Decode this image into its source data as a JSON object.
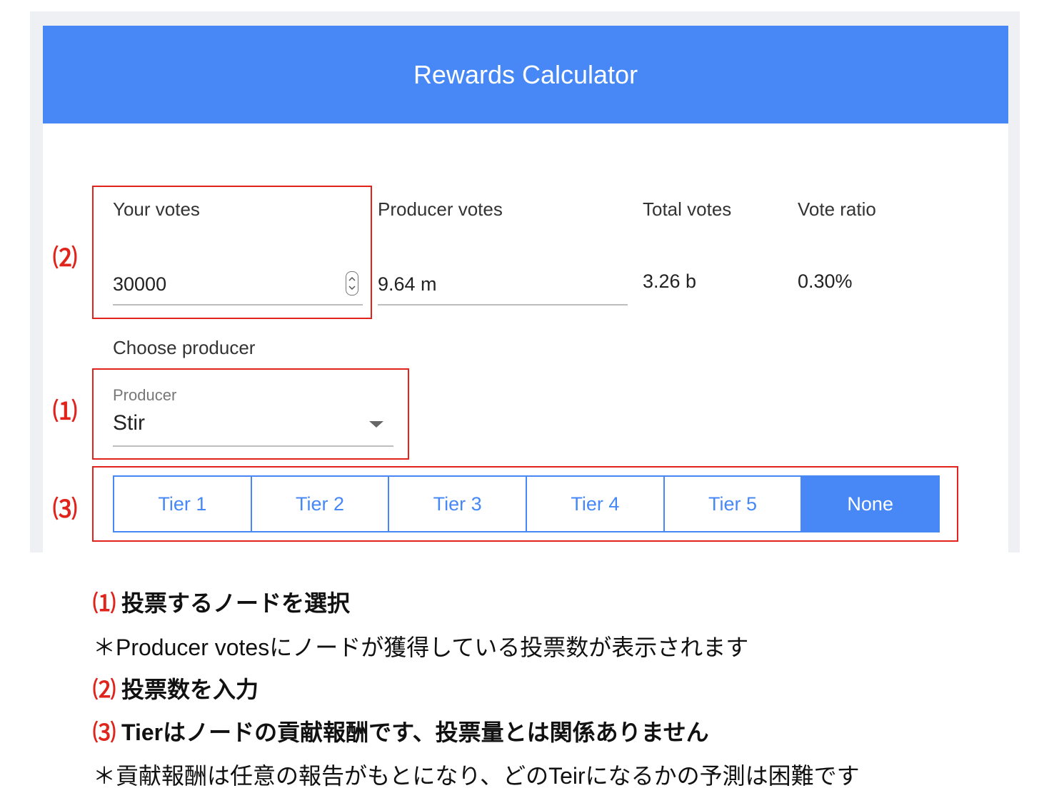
{
  "header": {
    "title": "Rewards Calculator"
  },
  "fields": {
    "your_votes": {
      "label": "Your votes",
      "value": "30000"
    },
    "producer_votes": {
      "label": "Producer votes",
      "value": "9.64 m"
    },
    "total_votes": {
      "label": "Total votes",
      "value": "3.26 b"
    },
    "vote_ratio": {
      "label": "Vote ratio",
      "value": "0.30%"
    }
  },
  "producer": {
    "section_label": "Choose producer",
    "float_label": "Producer",
    "selected": "Stir"
  },
  "tiers": [
    {
      "label": "Tier 1",
      "active": false
    },
    {
      "label": "Tier 2",
      "active": false
    },
    {
      "label": "Tier 3",
      "active": false
    },
    {
      "label": "Tier 4",
      "active": false
    },
    {
      "label": "Tier 5",
      "active": false
    },
    {
      "label": "None",
      "active": true
    }
  ],
  "markers": {
    "m1": "⑴",
    "m2": "⑵",
    "m3": "⑶"
  },
  "notes": {
    "line1_marker": "⑴",
    "line1_text": "投票するノードを選択",
    "line2_text": "＊Producer votesにノードが獲得している投票数が表示されます",
    "line3_marker": "⑵",
    "line3_text": "投票数を入力",
    "line4_marker": "⑶",
    "line4_text": "Tierはノードの貢献報酬です、投票量とは関係ありません",
    "line5_text": "＊貢献報酬は任意の報告がもとになり、どのTeirになるかの予測は困難です"
  },
  "colors": {
    "accent": "#4788f6",
    "annotation": "#e0231b"
  }
}
